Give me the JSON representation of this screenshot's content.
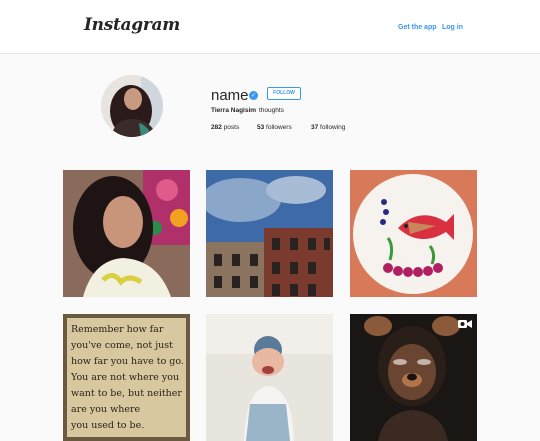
{
  "header": {
    "logo_text": "Instagram",
    "get_app_label": "Get the app",
    "login_label": "Log in"
  },
  "profile": {
    "username": "name",
    "verified_icon": "verified-badge-icon",
    "follow_label": "FOLLOW",
    "full_name": "Tierra Nagisim",
    "bio": "thoughts",
    "posts_count": "282",
    "posts_label": "posts",
    "followers_count": "53",
    "followers_label": "followers",
    "following_count": "37",
    "following_label": "following"
  },
  "posts": [
    {
      "kind": "photo",
      "subject": "selfie-woman-floral-background"
    },
    {
      "kind": "photo",
      "subject": "brick-buildings-blue-sky"
    },
    {
      "kind": "photo",
      "subject": "fruit-fish-plate"
    },
    {
      "kind": "photo",
      "subject": "quote-text",
      "quote_lines": [
        "Remember how far",
        "you've come, not just",
        "how far you have to go.",
        "You are not where you",
        "want to be, but neither",
        "are you where",
        "you used to be."
      ]
    },
    {
      "kind": "photo",
      "subject": "baby-laughing"
    },
    {
      "kind": "video",
      "subject": "dog-filter-selfie",
      "badge_icon": "video-camera-icon"
    }
  ],
  "colors": {
    "accent": "#3897f0",
    "text": "#262626",
    "background": "#fafafa"
  }
}
